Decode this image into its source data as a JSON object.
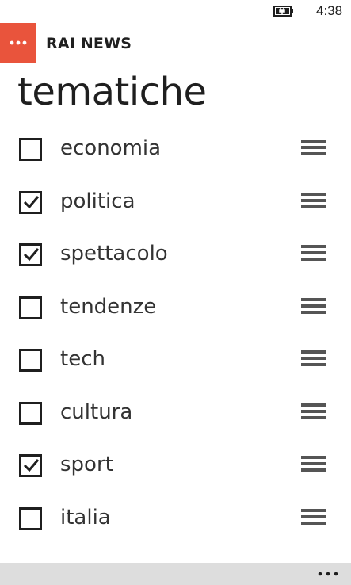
{
  "status_bar": {
    "time": "4:38",
    "battery_icon": "battery-charging-icon"
  },
  "header": {
    "app_name": "RAI NEWS",
    "menu_icon": "more-dots-icon",
    "accent_color": "#e9543c"
  },
  "page": {
    "title": "tematiche"
  },
  "topics": [
    {
      "label": "economia",
      "checked": false
    },
    {
      "label": "politica",
      "checked": true
    },
    {
      "label": "spettacolo",
      "checked": true
    },
    {
      "label": "tendenze",
      "checked": false
    },
    {
      "label": "tech",
      "checked": false
    },
    {
      "label": "cultura",
      "checked": false
    },
    {
      "label": "sport",
      "checked": true
    },
    {
      "label": "italia",
      "checked": false
    }
  ],
  "app_bar": {
    "more_icon": "ellipsis-icon",
    "background": "#dddddd"
  }
}
